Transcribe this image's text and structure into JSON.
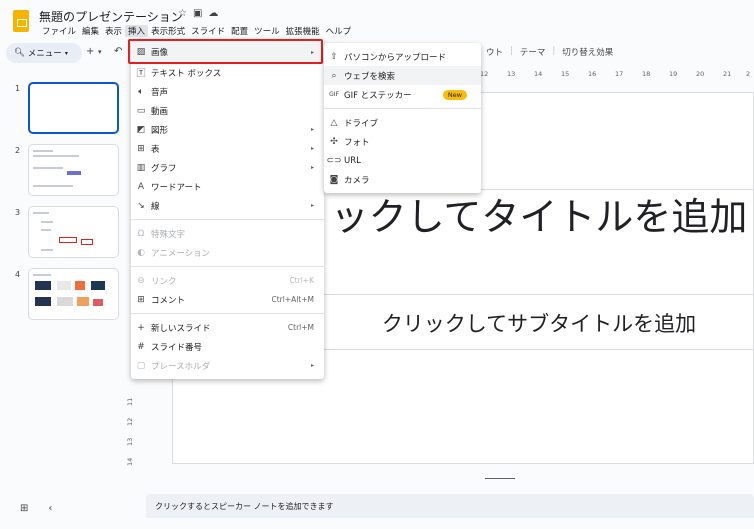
{
  "doc": {
    "title": "無題のプレゼンテーション"
  },
  "menubar": [
    "ファイル",
    "編集",
    "表示",
    "挿入",
    "表示形式",
    "スライド",
    "配置",
    "ツール",
    "拡張機能",
    "ヘルプ"
  ],
  "toolbar": {
    "menu_search": "メニュー",
    "right_items": [
      "ウト",
      "テーマ",
      "切り替え効果"
    ]
  },
  "thumbnails": [
    "1",
    "2",
    "3",
    "4"
  ],
  "ruler": [
    "12",
    "13",
    "14",
    "15",
    "16",
    "17",
    "18",
    "19",
    "20",
    "21",
    "2"
  ],
  "vruler": [
    "11",
    "12",
    "13",
    "14"
  ],
  "slide": {
    "title": "ックしてタイトルを追加",
    "subtitle": "クリックしてサブタイトルを追加"
  },
  "notes": {
    "placeholder": "クリックするとスピーカー ノートを追加できます"
  },
  "insert_menu": {
    "image": "画像",
    "textbox": "テキスト ボックス",
    "audio": "音声",
    "video": "動画",
    "shape": "図形",
    "table": "表",
    "chart": "グラフ",
    "wordart": "ワードアート",
    "line": "線",
    "special_chars": "特殊文字",
    "animation": "アニメーション",
    "link": "リンク",
    "link_shortcut": "Ctrl+K",
    "comment": "コメント",
    "comment_shortcut": "Ctrl+Alt+M",
    "new_slide": "新しいスライド",
    "new_slide_shortcut": "Ctrl+M",
    "slide_numbers": "スライド番号",
    "placeholder": "プレースホルダ"
  },
  "image_submenu": {
    "upload": "パソコンからアップロード",
    "search_web": "ウェブを検索",
    "gif": "GIF とステッカー",
    "gif_badge": "New",
    "drive": "ドライブ",
    "photos": "フォト",
    "url": "URL",
    "camera": "カメラ"
  },
  "colors": {
    "highlight": "#e3201b",
    "accent": "#0b57d0",
    "badge": "#fbbc04",
    "logo": "#f4b400"
  }
}
